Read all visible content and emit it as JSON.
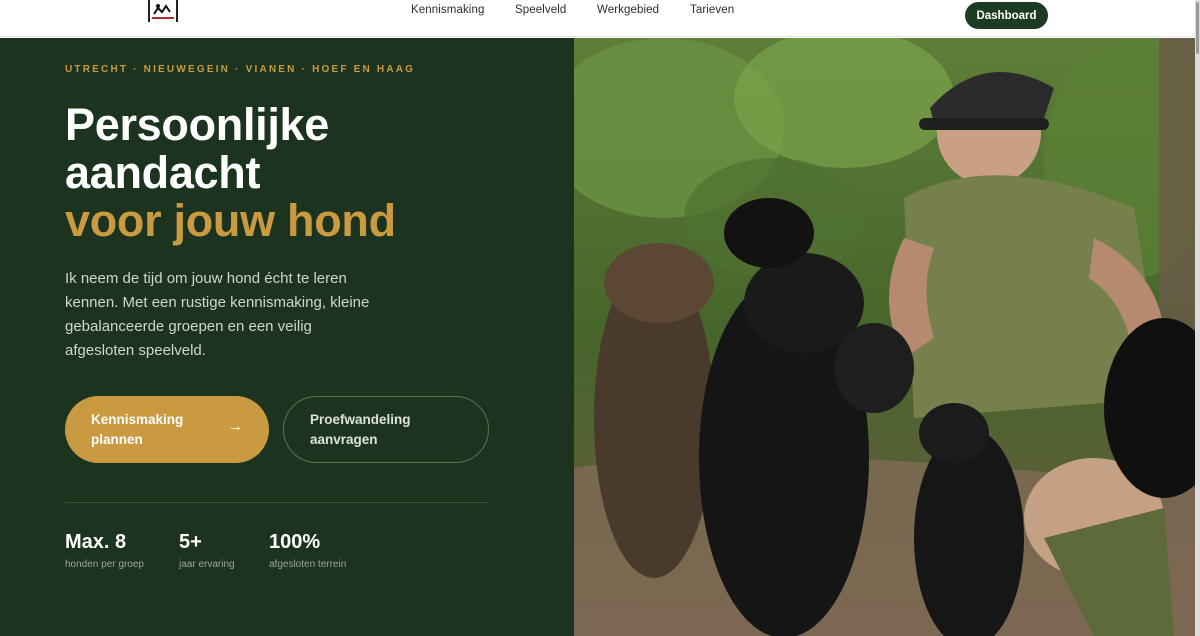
{
  "nav": {
    "links": [
      "Kennismaking",
      "Speelveld",
      "Werkgebied",
      "Tarieven"
    ],
    "dashboard": "Dashboard"
  },
  "hero": {
    "eyebrow": "UTRECHT · NIEUWEGEIN · VIANEN · HOEF EN HAAG",
    "title_line1": "Persoonlijke",
    "title_line2": "aandacht",
    "title_accent": "voor jouw hond",
    "lead": "Ik neem de tijd om jouw hond écht te leren kennen. Met een rustige kennismaking, kleine gebalanceerde groepen en een veilig afgesloten speelveld.",
    "cta_primary": "Kennismaking plannen",
    "cta_primary_arrow": "→",
    "cta_secondary": "Proefwandeling aanvragen"
  },
  "stats": [
    {
      "value": "Max. 8",
      "caption": "honden per groep"
    },
    {
      "value": "5+",
      "caption": "jaar ervaring"
    },
    {
      "value": "100%",
      "caption": "afgesloten terrein"
    }
  ],
  "colors": {
    "forest": "#1c3320",
    "gold": "#c99a40",
    "button_dark": "#1d3a23"
  }
}
